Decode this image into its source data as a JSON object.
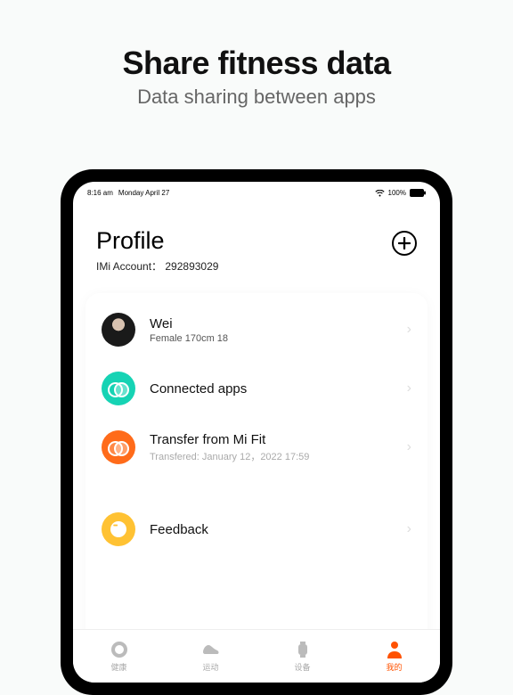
{
  "promo": {
    "title": "Share fitness data",
    "subtitle": "Data sharing between apps"
  },
  "statusbar": {
    "time": "8:16 am",
    "date": "Monday April 27",
    "battery": "100%"
  },
  "profile": {
    "title": "Profile",
    "account_label": "IMi Account：",
    "account_id": "292893029"
  },
  "user": {
    "name": "Wei",
    "meta": "Female 170cm  18"
  },
  "rows": {
    "connected": {
      "title": "Connected apps"
    },
    "transfer": {
      "title": "Transfer from Mi Fit",
      "sub": "Transfered: January 12，2022 17:59"
    },
    "feedback": {
      "title": "Feedback"
    }
  },
  "tabs": {
    "health": "健康",
    "workout": "运动",
    "device": "设备",
    "mine": "我的"
  }
}
